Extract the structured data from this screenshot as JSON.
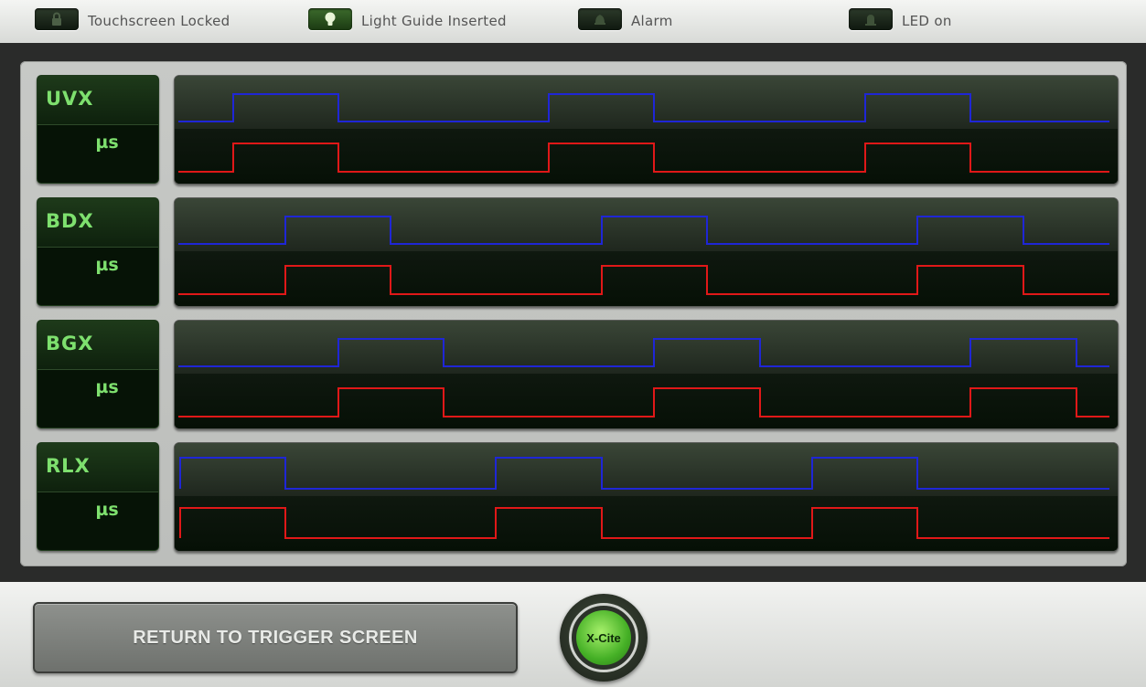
{
  "status_bar": {
    "indicators": [
      {
        "label": "Touchscreen Locked",
        "state": "off",
        "icon": "padlock-icon"
      },
      {
        "label": "Light Guide Inserted",
        "state": "on",
        "icon": "lightbulb-icon"
      },
      {
        "label": "Alarm",
        "state": "off",
        "icon": "alarm-bell-icon"
      },
      {
        "label": "LED on",
        "state": "off",
        "icon": "led-icon"
      }
    ]
  },
  "channels": [
    {
      "name": "UVX",
      "unit": "µs"
    },
    {
      "name": "BDX",
      "unit": "µs"
    },
    {
      "name": "BGX",
      "unit": "µs"
    },
    {
      "name": "RLX",
      "unit": "µs"
    }
  ],
  "colors": {
    "trace_top": "#1f26d6",
    "trace_bottom": "#e01818",
    "label_text": "#7ee06e"
  },
  "footer": {
    "return_button_label": "RETURN TO TRIGGER SCREEN",
    "logo_label": "X-Cite"
  }
}
